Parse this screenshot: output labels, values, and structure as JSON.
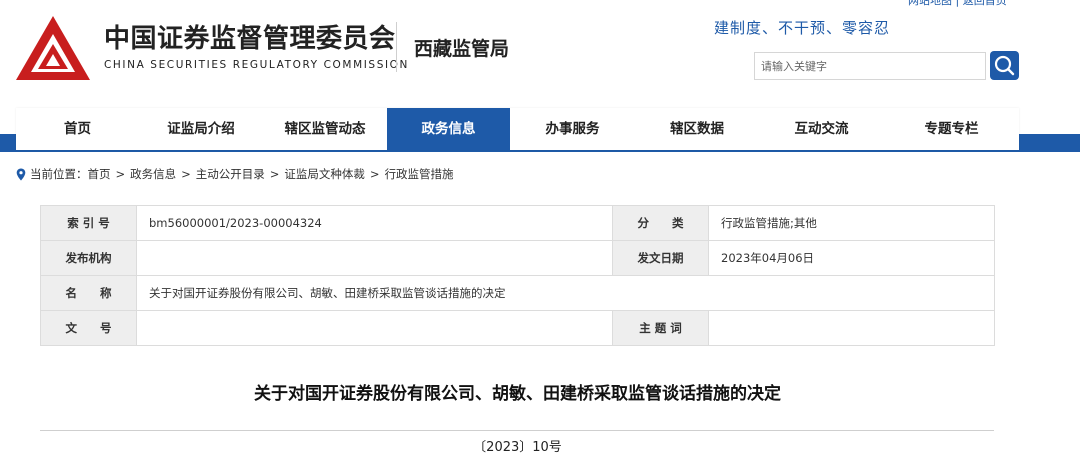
{
  "header": {
    "org_name_cn": "中国证券监督管理委员会",
    "org_name_en": "CHINA SECURITIES REGULATORY COMMISSION",
    "bureau": "西藏监管局",
    "top_links": "网站地图 | 返回首页",
    "slogan": "建制度、不干预、零容忍",
    "search": {
      "placeholder": "请输入关键字"
    },
    "brand_color": "#c81e1e",
    "accent_color": "#1e5aa8"
  },
  "nav": {
    "items": [
      {
        "label": "首页"
      },
      {
        "label": "证监局介绍"
      },
      {
        "label": "辖区监管动态"
      },
      {
        "label": "政务信息",
        "active": true
      },
      {
        "label": "办事服务"
      },
      {
        "label": "辖区数据"
      },
      {
        "label": "互动交流"
      },
      {
        "label": "专题专栏"
      }
    ]
  },
  "breadcrumb": {
    "prefix": "当前位置：",
    "items": [
      "首页",
      "政务信息",
      "主动公开目录",
      "证监局文种体裁",
      "行政监管措施"
    ],
    "separator": ">"
  },
  "meta": {
    "index_label": "索 引 号",
    "index_value": "bm56000001/2023-00004324",
    "category_label": "分　　类",
    "category_value": "行政监管措施;其他",
    "publisher_label": "发布机构",
    "publisher_value": "",
    "date_label": "发文日期",
    "date_value": "2023年04月06日",
    "name_label": "名　　称",
    "name_value": "关于对国开证券股份有限公司、胡敏、田建桥采取监管谈话措施的决定",
    "docno_label": "文　　号",
    "docno_value": "",
    "subject_label": "主 题 词",
    "subject_value": ""
  },
  "document": {
    "title": "关于对国开证券股份有限公司、胡敏、田建桥采取监管谈话措施的决定",
    "number": "〔2023〕10号"
  }
}
